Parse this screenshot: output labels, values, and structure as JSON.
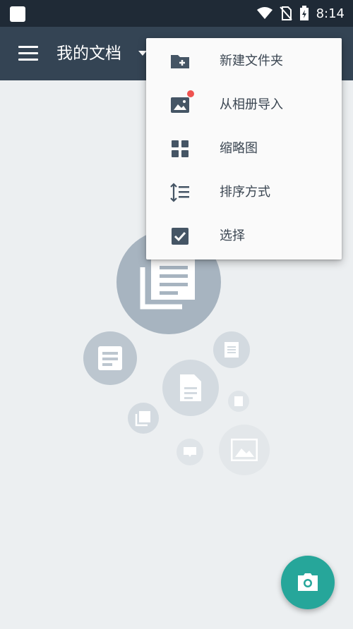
{
  "status_bar": {
    "time": "8:14",
    "icons": [
      "app-icon",
      "wifi-icon",
      "no-sim-icon",
      "battery-charging-icon"
    ]
  },
  "toolbar": {
    "title": "我的文档",
    "menu_icon": "hamburger-icon",
    "dropdown_icon": "caret-down-icon"
  },
  "menu": {
    "items": [
      {
        "label": "新建文件夹",
        "icon": "folder-add-icon"
      },
      {
        "label": "从相册导入",
        "icon": "image-icon",
        "badge": true
      },
      {
        "label": "缩略图",
        "icon": "grid-icon"
      },
      {
        "label": "排序方式",
        "icon": "sort-icon"
      },
      {
        "label": "选择",
        "icon": "checkbox-icon"
      }
    ]
  },
  "fab": {
    "icon": "camera-icon"
  },
  "colors": {
    "toolbar": "#344454",
    "status_bar": "#1f2a36",
    "fab": "#26a69a",
    "background": "#eceff1",
    "badge": "#ef5350"
  }
}
